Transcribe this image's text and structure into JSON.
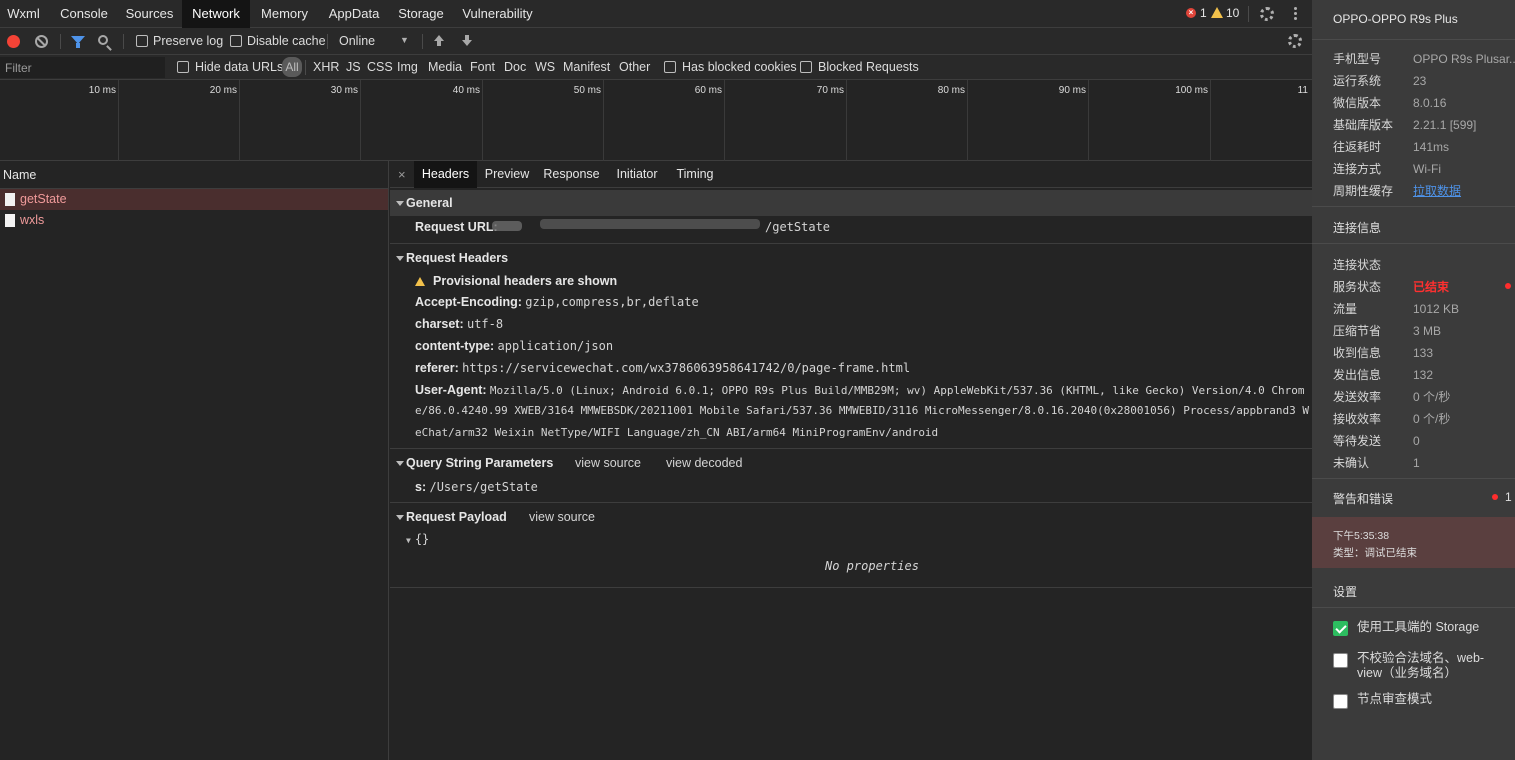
{
  "tabs": [
    "Wxml",
    "Console",
    "Sources",
    "Network",
    "Memory",
    "AppData",
    "Storage",
    "Vulnerability"
  ],
  "active_tab": "Network",
  "status_counts": {
    "errors": "1",
    "warnings": "10"
  },
  "toolbar": {
    "preserve_log": "Preserve log",
    "disable_cache": "Disable cache",
    "throttling": "Online",
    "throttling_caret": "▼"
  },
  "filter_bar": {
    "placeholder": "Filter",
    "hide_data_urls": "Hide data URLs",
    "all": "All",
    "types": [
      "XHR",
      "JS",
      "CSS",
      "Img",
      "Media",
      "Font",
      "Doc",
      "WS",
      "Manifest",
      "Other"
    ],
    "has_blocked_cookies": "Has blocked cookies",
    "blocked_requests": "Blocked Requests"
  },
  "timeline_ticks": [
    "10 ms",
    "20 ms",
    "30 ms",
    "40 ms",
    "50 ms",
    "60 ms",
    "70 ms",
    "80 ms",
    "90 ms",
    "100 ms",
    "11"
  ],
  "requests": {
    "header": "Name",
    "items": [
      "getState",
      "wxls"
    ]
  },
  "detail": {
    "close": "×",
    "tabs": [
      "Headers",
      "Preview",
      "Response",
      "Initiator",
      "Timing"
    ],
    "general": {
      "title": "General",
      "request_url_label": "Request URL:",
      "request_url_value": "/getState"
    },
    "request_headers": {
      "title": "Request Headers",
      "provisional": "Provisional headers are shown",
      "accept_encoding_k": "Accept-Encoding:",
      "accept_encoding_v": "gzip,compress,br,deflate",
      "charset_k": "charset:",
      "charset_v": "utf-8",
      "content_type_k": "content-type:",
      "content_type_v": "application/json",
      "referer_k": "referer:",
      "referer_v": "https://servicewechat.com/wx3786063958641742/0/page-frame.html",
      "user_agent_k": "User-Agent:",
      "user_agent_v1": "Mozilla/5.0 (Linux; Android 6.0.1; OPPO R9s Plus Build/MMB29M; wv) AppleWebKit/537.36 (KHTML, like Gecko) Version/4.0 Chrom",
      "user_agent_v2": "e/86.0.4240.99 XWEB/3164 MMWEBSDK/20211001 Mobile Safari/537.36 MMWEBID/3116 MicroMessenger/8.0.16.2040(0x28001056) Process/appbrand3 W",
      "user_agent_v3": "eChat/arm32 Weixin NetType/WIFI Language/zh_CN ABI/arm64 MiniProgramEnv/android"
    },
    "query_string": {
      "title": "Query String Parameters",
      "view_source": "view source",
      "view_decoded": "view decoded",
      "param_k": "s:",
      "param_v": "/Users/getState"
    },
    "payload": {
      "title": "Request Payload",
      "view_source": "view source",
      "root": "{}",
      "empty": "No properties"
    }
  },
  "side": {
    "title": "OPPO-OPPO R9s Plus",
    "device_info": [
      {
        "k": "手机型号",
        "v": "OPPO R9s Plusar..."
      },
      {
        "k": "运行系统",
        "v": "23"
      },
      {
        "k": "微信版本",
        "v": "8.0.16"
      },
      {
        "k": "基础库版本",
        "v": "2.21.1 [599]"
      },
      {
        "k": "往返耗时",
        "v": "141ms"
      },
      {
        "k": "连接方式",
        "v": "Wi-Fi"
      },
      {
        "k": "周期性缓存",
        "v": "拉取数据"
      }
    ],
    "conn_title": "连接信息",
    "conn_info": [
      {
        "k": "连接状态",
        "v": ""
      },
      {
        "k": "服务状态",
        "v": "已结束"
      },
      {
        "k": "流量",
        "v": "1012 KB"
      },
      {
        "k": "压缩节省",
        "v": "3 MB"
      },
      {
        "k": "收到信息",
        "v": "133"
      },
      {
        "k": "发出信息",
        "v": "132"
      },
      {
        "k": "发送效率",
        "v": "0 个/秒"
      },
      {
        "k": "接收效率",
        "v": "0 个/秒"
      },
      {
        "k": "等待发送",
        "v": "0"
      },
      {
        "k": "未确认",
        "v": "1"
      }
    ],
    "warnings_title": "警告和错误",
    "warnings_count": "1",
    "log_time": "下午5:35:38",
    "log_type": "类型：调试已结束",
    "settings_title": "设置",
    "settings": [
      {
        "label": "使用工具端的 Storage",
        "checked": true
      },
      {
        "label": "不校验合法域名、web-view（业务域名）",
        "checked": false
      },
      {
        "label": "节点审查模式",
        "checked": false
      }
    ],
    "colors": {
      "link": "#4e93e9",
      "status_ended": "#ff3030",
      "check_green": "#2dbd60"
    }
  }
}
